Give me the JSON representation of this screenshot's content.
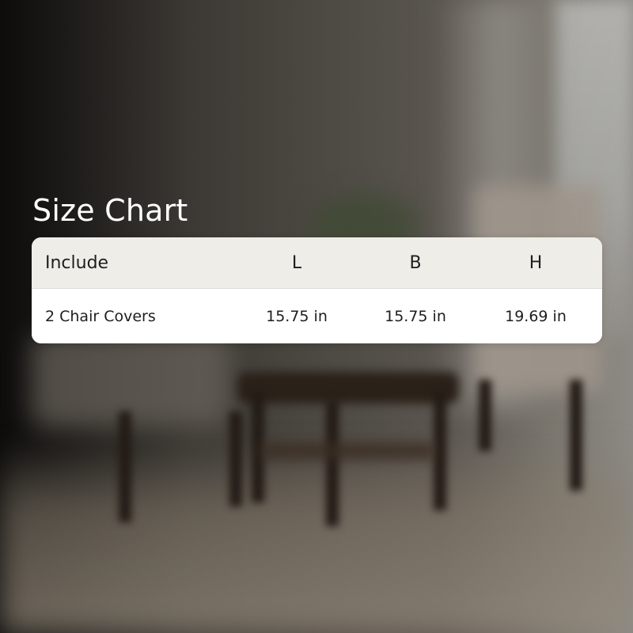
{
  "title": "Size Chart",
  "table": {
    "headers": [
      "Include",
      "L",
      "B",
      "H"
    ],
    "rows": [
      [
        "2 Chair Covers",
        "15.75 in",
        "15.75 in",
        "19.69 in"
      ]
    ]
  },
  "colors": {
    "title_text": "#ffffff",
    "header_bg": "#eeede8",
    "body_bg": "#ffffff",
    "cell_text": "#1e1e1e"
  }
}
